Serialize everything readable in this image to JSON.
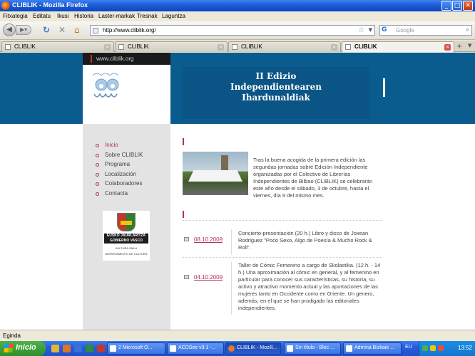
{
  "window": {
    "title": "CLIBLIK - Mozilla Firefox"
  },
  "menu": [
    "Fitxategia",
    "Editatu",
    "Ikusi",
    "Historia",
    "Laster-markak",
    "Tresnak",
    "Laguntza"
  ],
  "toolbar": {
    "url": "http://www.cliblik.org/",
    "search_placeholder": "Google",
    "search_engine": "G"
  },
  "tabs": [
    {
      "label": "CLIBLIK"
    },
    {
      "label": "CLIBLIK"
    },
    {
      "label": "CLIBLIK"
    },
    {
      "label": "CLIBLIK"
    }
  ],
  "site": {
    "url_label": "www.cliblik.org",
    "banner_line1": "II Edizio",
    "banner_line2": "Independientearen",
    "banner_line3": "Ihardunaldiak",
    "nav": [
      {
        "label": "Inicio"
      },
      {
        "label": "Sobre CLIBLIK"
      },
      {
        "label": "Programa"
      },
      {
        "label": "Localización"
      },
      {
        "label": "Colaboradores"
      },
      {
        "label": "Contacta"
      }
    ],
    "sponsor": {
      "line1": "EUSKO JAURLARITZA",
      "line2": "GOBIERNO VASCO",
      "line3": "KULTURA SAILA",
      "line4": "DEPARTAMENTO DE CULTURA"
    },
    "intro": "Tras la buena acogida de la primera edición las segundas jornadas sobre Edición Independiente organizadas por el Colectivo de Librerías Independientes de Bilbao (CLIBLIK) se celebrarán este año desde el sábado, 3 de octubre, hasta el viernes, día 9 del mismo mes.",
    "events": [
      {
        "date": "08.10.2009",
        "text": "Concierto-presentación (20 h.) Libro y disco de Joxean Rodriguez \"Poco Sexo, Algo de Poesía & Mucho Rock & Roll\"."
      },
      {
        "date": "04.10.2009",
        "text": "Taller de Cómic Femenino a cargo de Skolastika. (12 h. - 14 h.) Una aproximación al cómic en general, y al femenino en particular para conocer sus características, su historia, su activo y atractivo momento actual y las aportaciones de las mujeres tanto en Occidente como en Oriente. Un genero, además, en el que se han prodigado las editoriales independientes."
      }
    ]
  },
  "status": {
    "text": "Egindа"
  },
  "taskbar": {
    "start": "Inicio",
    "items": [
      {
        "label": "2 Microsoft O..."
      },
      {
        "label": "ACDSee v3.1 -..."
      },
      {
        "label": "CLIBLIK - Mozill..."
      },
      {
        "label": "Sin título - Bloc ..."
      },
      {
        "label": "Admina Bizkaie ..."
      }
    ],
    "lang": "EU",
    "clock": "13:52"
  }
}
